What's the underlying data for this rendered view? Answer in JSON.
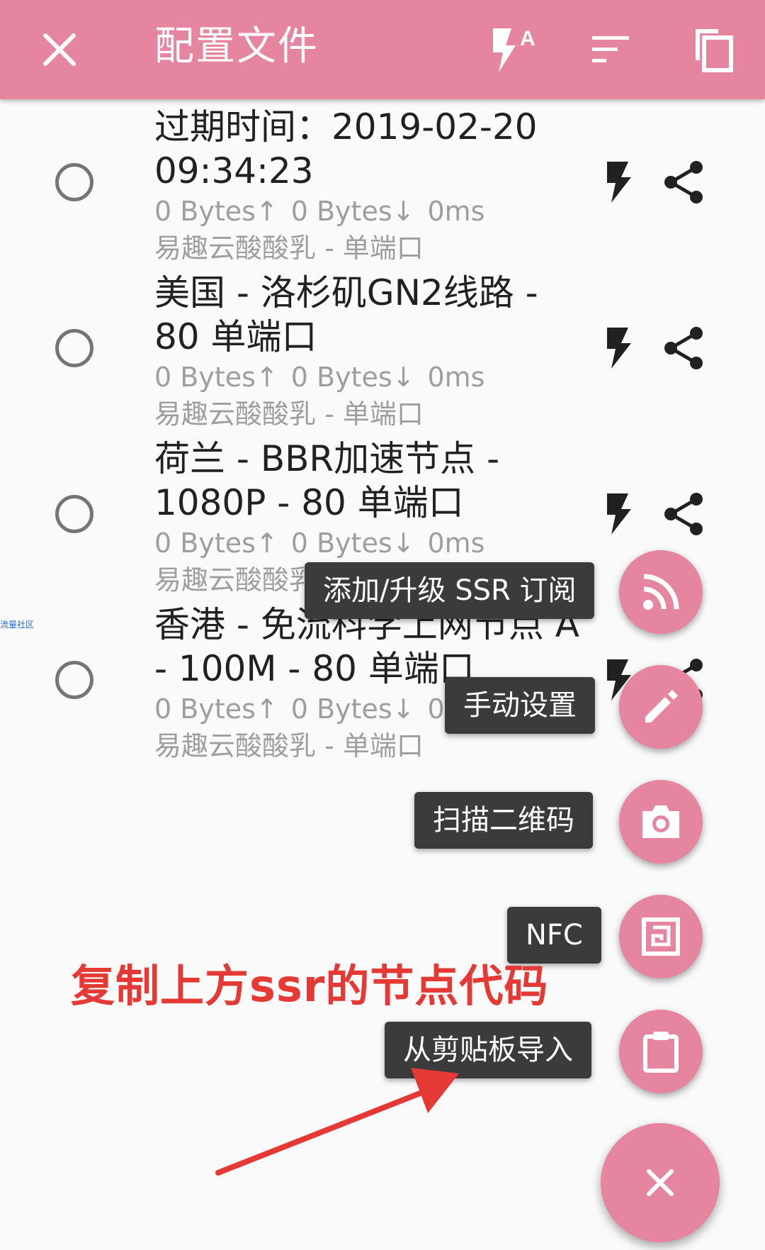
{
  "appbar": {
    "title": "配置文件",
    "close_icon": "close-icon",
    "test_icon": "flash-auto-icon",
    "sort_icon": "sort-icon",
    "copy_icon": "copy-icon"
  },
  "profiles": [
    {
      "name": "过期时间：2019-02-20 09:34:23",
      "tx": "0 Bytes↑",
      "rx": "0 Bytes↓",
      "latency": "0ms",
      "group": "易趣云酸酸乳 - 单端口"
    },
    {
      "name": "美国 - 洛杉矶GN2线路 - 80 单端口",
      "tx": "0 Bytes↑",
      "rx": "0 Bytes↓",
      "latency": "0ms",
      "group": "易趣云酸酸乳 - 单端口"
    },
    {
      "name": "荷兰 - BBR加速节点 - 1080P - 80 单端口",
      "tx": "0 Bytes↑",
      "rx": "0 Bytes↓",
      "latency": "0ms",
      "group": "易趣云酸酸乳 - 单端口"
    },
    {
      "name": "香港 - 免流科学上网节点 A - 100M - 80 单端口",
      "tx": "0 Bytes↑",
      "rx": "0 Bytes↓",
      "latency": "0ms",
      "group": "易趣云酸酸乳 - 单端口"
    }
  ],
  "speed_dial": {
    "subscription": "添加/升级 SSR 订阅",
    "manual": "手动设置",
    "scan": "扫描二维码",
    "nfc": "NFC",
    "clipboard": "从剪贴板导入"
  },
  "annotation": "复制上方ssr的节点代码",
  "watermark": "流量社区",
  "colors": {
    "accent": "#e5859f",
    "chip_bg": "#3b3b3b",
    "annotation": "#e53935"
  }
}
